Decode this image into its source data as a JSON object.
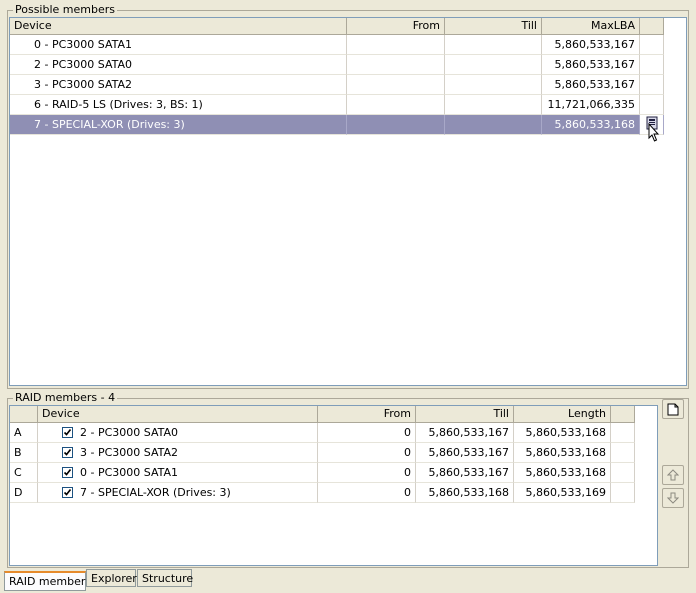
{
  "possible": {
    "title": "Possible members",
    "columns": [
      "Device",
      "From",
      "Till",
      "MaxLBA"
    ],
    "rows": [
      {
        "device": "0 - PC3000 SATA1",
        "from": "",
        "till": "",
        "maxlba": "5,860,533,167"
      },
      {
        "device": "2 - PC3000 SATA0",
        "from": "",
        "till": "",
        "maxlba": "5,860,533,167"
      },
      {
        "device": "3 - PC3000 SATA2",
        "from": "",
        "till": "",
        "maxlba": "5,860,533,167"
      },
      {
        "device": "6 - RAID-5 LS (Drives: 3, BS: 1)",
        "from": "",
        "till": "",
        "maxlba": "11,721,066,335"
      },
      {
        "device": "7 - SPECIAL-XOR (Drives: 3)",
        "from": "",
        "till": "",
        "maxlba": "5,860,533,168"
      }
    ],
    "selected_index": 4
  },
  "raid": {
    "title": "RAID members - 4",
    "columns": [
      "Device",
      "From",
      "Till",
      "Length"
    ],
    "rows": [
      {
        "letter": "A",
        "checked": true,
        "device": "2 - PC3000 SATA0",
        "from": "0",
        "till": "5,860,533,167",
        "length": "5,860,533,168"
      },
      {
        "letter": "B",
        "checked": true,
        "device": "3 - PC3000 SATA2",
        "from": "0",
        "till": "5,860,533,167",
        "length": "5,860,533,168"
      },
      {
        "letter": "C",
        "checked": true,
        "device": "0 - PC3000 SATA1",
        "from": "0",
        "till": "5,860,533,167",
        "length": "5,860,533,168"
      },
      {
        "letter": "D",
        "checked": true,
        "device": "7 - SPECIAL-XOR (Drives: 3)",
        "from": "0",
        "till": "5,860,533,168",
        "length": "5,860,533,169"
      }
    ]
  },
  "side_buttons": {
    "new_icon": "new-document-icon",
    "up_icon": "arrow-up-icon",
    "down_icon": "arrow-down-icon"
  },
  "tabs": [
    {
      "label": "RAID members",
      "active": true
    },
    {
      "label": "Explorer",
      "active": false
    },
    {
      "label": "Structure",
      "active": false
    }
  ],
  "colors": {
    "selection": "#8f8fb4",
    "background": "#ece9d8",
    "tab_accent": "#e68b2c"
  }
}
